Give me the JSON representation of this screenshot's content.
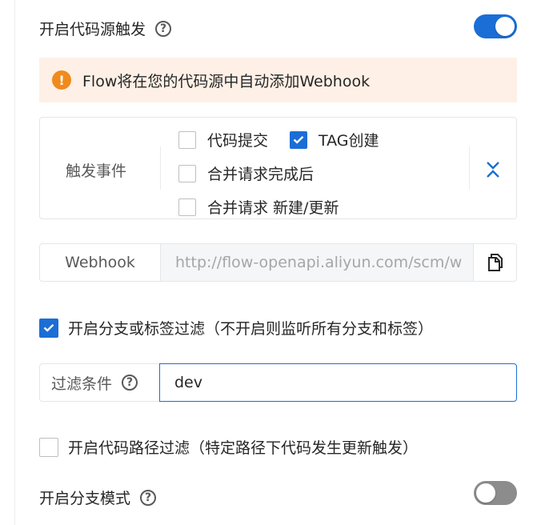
{
  "code_source_trigger": {
    "label": "开启代码源触发",
    "enabled": true
  },
  "alert": {
    "text": "Flow将在您的代码源中自动添加Webhook"
  },
  "trigger_events": {
    "label": "触发事件",
    "options": [
      {
        "label": "代码提交",
        "checked": false
      },
      {
        "label": "TAG创建",
        "checked": true
      },
      {
        "label": "合并请求完成后",
        "checked": false
      },
      {
        "label": "合并请求 新建/更新",
        "checked": false
      }
    ]
  },
  "webhook": {
    "label": "Webhook",
    "url": "http://flow-openapi.aliyun.com/scm/w"
  },
  "branch_tag_filter": {
    "label": "开启分支或标签过滤（不开启则监听所有分支和标签）",
    "checked": true
  },
  "filter_condition": {
    "label": "过滤条件",
    "value": "dev"
  },
  "path_filter": {
    "label": "开启代码路径过滤（特定路径下代码发生更新触发）",
    "checked": false
  },
  "branch_mode": {
    "label": "开启分支模式",
    "enabled": false
  },
  "colors": {
    "accent": "#1b6ed6",
    "warning": "#f08a1d",
    "alert_bg": "#fef0e6",
    "toggle_off": "#8c8c8c"
  }
}
